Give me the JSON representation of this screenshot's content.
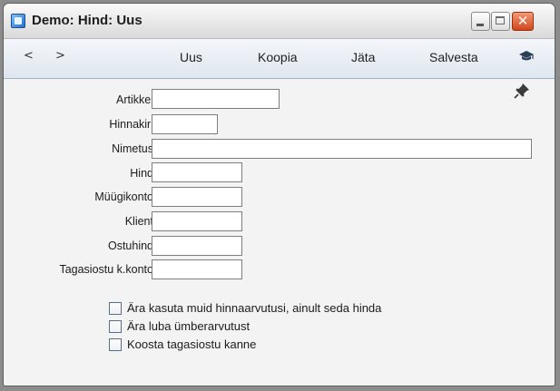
{
  "window": {
    "title": "Demo: Hind: Uus",
    "close_glyph": "✕"
  },
  "toolbar": {
    "prev": "<",
    "next": ">",
    "buttons": [
      "Uus",
      "Koopia",
      "Jäta",
      "Salvesta"
    ]
  },
  "form": {
    "fields": [
      {
        "label": "Artikkel",
        "value": ""
      },
      {
        "label": "Hinnakiri",
        "value": ""
      },
      {
        "label": "Nimetus",
        "value": ""
      },
      {
        "label": "Hind",
        "value": ""
      },
      {
        "label": "Müügikonto",
        "value": ""
      },
      {
        "label": "Klient",
        "value": ""
      },
      {
        "label": "Ostuhind",
        "value": ""
      },
      {
        "label": "Tagasiostu k.konto",
        "value": ""
      }
    ],
    "checkboxes": [
      {
        "label": "Ära kasuta muid hinnaarvutusi, ainult seda hinda",
        "checked": false
      },
      {
        "label": "Ära luba ümberarvutust",
        "checked": false
      },
      {
        "label": "Koosta tagasiostu kanne",
        "checked": false
      }
    ]
  },
  "icons": {
    "app": "app-window-icon",
    "help": "graduation-cap-icon",
    "pin": "pushpin-icon"
  }
}
